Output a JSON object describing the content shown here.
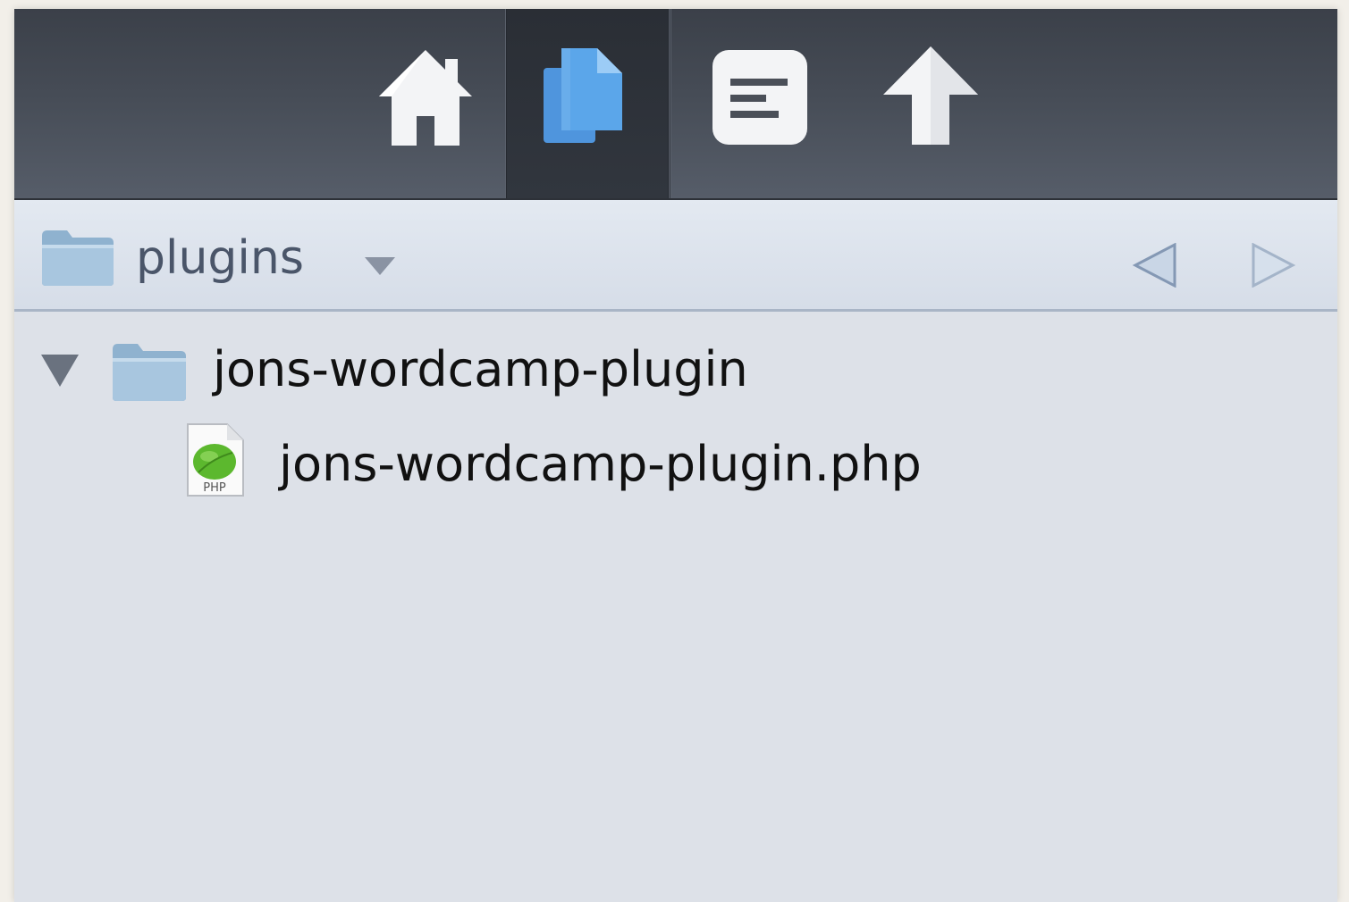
{
  "toolbar": {
    "buttons": [
      {
        "id": "home",
        "icon": "home-icon",
        "active": false
      },
      {
        "id": "files",
        "icon": "files-icon",
        "active": true
      },
      {
        "id": "info",
        "icon": "text-lines-icon",
        "active": false
      },
      {
        "id": "upload",
        "icon": "up-arrow-icon",
        "active": false
      }
    ]
  },
  "pathbar": {
    "current_folder": "plugins",
    "folder_icon": "folder-icon",
    "dropdown_icon": "chevron-down-icon",
    "back_icon": "back-arrow-icon",
    "forward_icon": "forward-arrow-icon"
  },
  "files": [
    {
      "name": "jons-wordcamp-plugin",
      "kind": "folder",
      "expanded": true,
      "icon": "folder-icon"
    },
    {
      "name": "jons-wordcamp-plugin.php",
      "kind": "file",
      "icon": "php-file-icon",
      "icon_text": "PHP"
    }
  ],
  "colors": {
    "toolbar_bg": "#464c56",
    "active_tool_bg": "#2e3239",
    "accent_blue": "#5aa3e6",
    "list_bg": "#dde1e8",
    "folder_blue": "#9fc0da",
    "php_green": "#5cb82e"
  }
}
